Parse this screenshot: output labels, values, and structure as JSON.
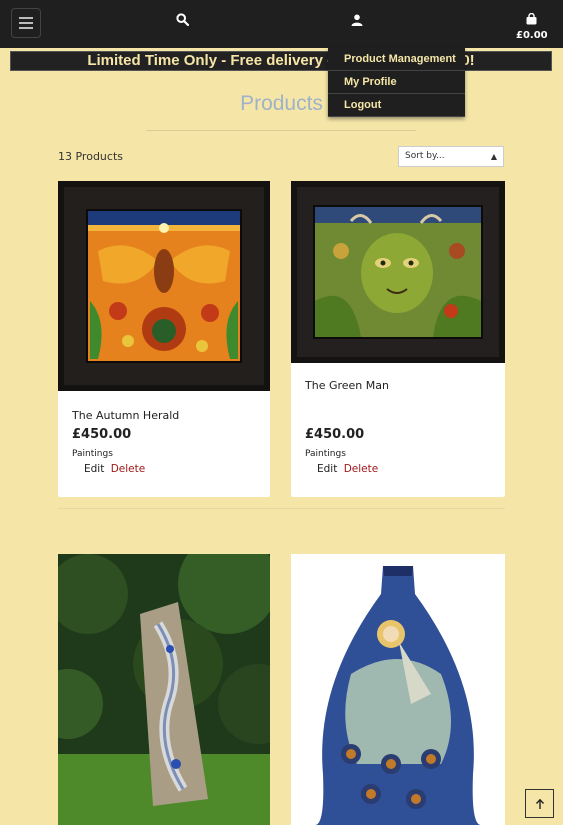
{
  "header": {
    "cart_total": "£0.00",
    "icons": {
      "menu": "hamburger-icon",
      "search": "search-icon",
      "account": "user-icon",
      "cart": "shopping-bag-icon"
    }
  },
  "banner": {
    "text": "Limited Time Only - Free delivery on orders over £100!"
  },
  "account_menu": {
    "items": [
      "Product Management",
      "My Profile",
      "Logout"
    ]
  },
  "main": {
    "title": "Products",
    "product_count": "13 Products",
    "sort": {
      "selected": "Sort by..."
    }
  },
  "products": [
    {
      "name": "The Autumn Herald",
      "price": "£450.00",
      "category": "Paintings",
      "edit_label": "Edit",
      "delete_label": "Delete"
    },
    {
      "name": "The Green Man",
      "price": "£450.00",
      "category": "Paintings",
      "edit_label": "Edit",
      "delete_label": "Delete"
    },
    {
      "name": "",
      "price": "",
      "category": ""
    },
    {
      "name": "",
      "price": "",
      "category": ""
    }
  ],
  "colors": {
    "background": "#f5e6a8",
    "navbar": "#1f1f1f",
    "accent_text": "#f5e6a8",
    "title": "#9fb3c8",
    "delete": "#a01818"
  }
}
